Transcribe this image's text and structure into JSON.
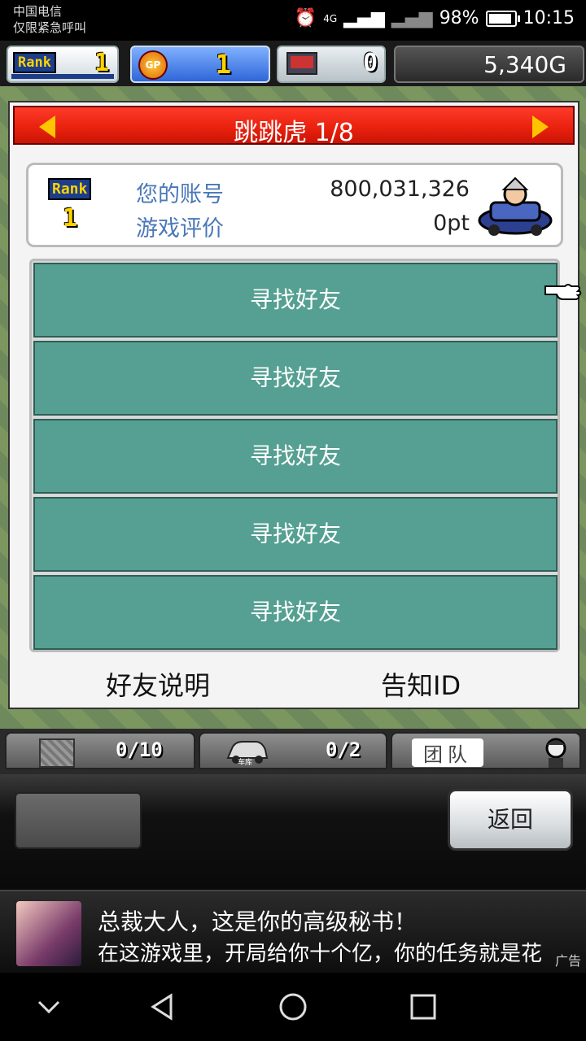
{
  "status_bar": {
    "carrier": "中国电信",
    "emergency": "仅限紧急呼叫",
    "network": "4G",
    "battery": "98%",
    "battery_level": 0.98,
    "time": "10:15"
  },
  "top_bar": {
    "rank_label": "Rank",
    "rank_value": "1",
    "gp_label": "GP",
    "gp_value": "1",
    "pc_value": "0",
    "gold": "5,340G"
  },
  "dialog": {
    "title": "跳跳虎 1/8",
    "profile": {
      "rank_label": "Rank",
      "rank_value": "1",
      "account_label": "您的账号",
      "account_value": "800,031,326",
      "rating_label": "游戏评价",
      "rating_value": "0pt"
    },
    "friend_rows": [
      {
        "label": "寻找好友"
      },
      {
        "label": "寻找好友"
      },
      {
        "label": "寻找好友"
      },
      {
        "label": "寻找好友"
      },
      {
        "label": "寻找好友"
      }
    ],
    "links": {
      "friend_help": "好友说明",
      "notify_id": "告知ID"
    }
  },
  "toolbar": {
    "box_count": "0/10",
    "garage_label": "车库",
    "garage_count": "0/2",
    "team_label": "团队"
  },
  "action_panel": {
    "back_button": "返回"
  },
  "ad": {
    "line1": "总裁大人，这是你的高级秘书！",
    "line2": "在这游戏里，开局给你十个亿，你的任务就是花",
    "tag": "广告"
  }
}
